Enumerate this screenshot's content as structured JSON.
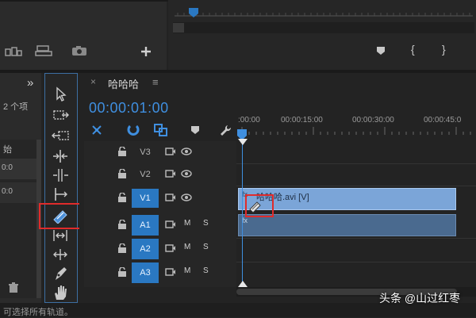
{
  "left_panel": {
    "count_text": "2 个项",
    "item1": "始",
    "time_a": "0:0",
    "time_b": "0:0",
    "expand_glyph": "»"
  },
  "sequence": {
    "name": "哈哈哈",
    "menu_glyph": "≡",
    "close_glyph": "×",
    "timecode": "00:00:01:00",
    "ruler": [
      ":00:00",
      "00:00:15:00",
      "00:00:30:00",
      "00:00:45:0"
    ]
  },
  "tracks": [
    {
      "name": "V3",
      "type": "video"
    },
    {
      "name": "V2",
      "type": "video"
    },
    {
      "name": "V1",
      "type": "video"
    },
    {
      "name": "A1",
      "type": "audio",
      "m": "M",
      "s": "S"
    },
    {
      "name": "A2",
      "type": "audio",
      "m": "M",
      "s": "S"
    },
    {
      "name": "A3",
      "type": "audio",
      "m": "M",
      "s": "S"
    }
  ],
  "clip": {
    "label": "哈哈哈.avi [V]",
    "fx": "fx"
  },
  "status_text": "可选择所有轨道。",
  "watermark": "头条 @山过红枣",
  "program": {
    "buttons": [
      "{",
      "}"
    ]
  },
  "colors": {
    "accent": "#2a78c2",
    "clip_video": "#7ba5d8",
    "clip_audio": "#4a6a8f",
    "highlight": "#e02b2b"
  }
}
